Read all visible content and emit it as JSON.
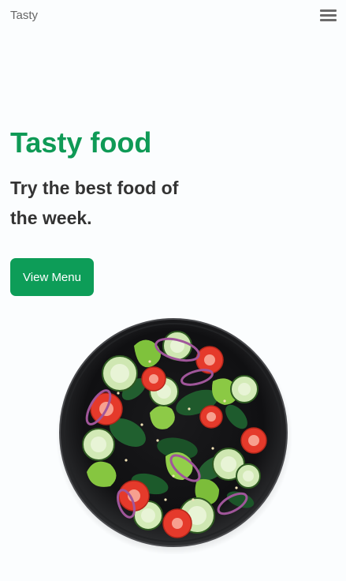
{
  "navbar": {
    "brand": "Tasty",
    "menu_icon": "hamburger-menu-icon"
  },
  "hero": {
    "title": "Tasty food",
    "subtitle": "Try the best food of the week.",
    "cta_label": "View Menu"
  },
  "image": {
    "alt": "Salad bowl"
  },
  "colors": {
    "accent": "#0f9a56",
    "button": "#0d9d58",
    "text": "#333333",
    "muted": "#666666",
    "background": "#fbfdfe"
  }
}
